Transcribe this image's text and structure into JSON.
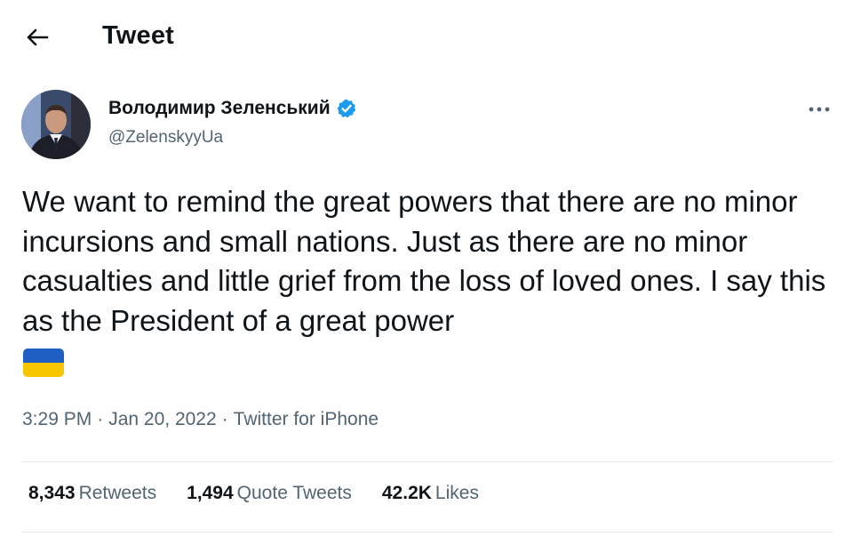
{
  "header": {
    "title": "Tweet",
    "back_icon": "arrow-left-icon"
  },
  "tweet": {
    "author": {
      "name": "Володимир Зеленський",
      "handle": "@ZelenskyyUa",
      "verified_icon": "verified-badge-icon",
      "verified_color": "#1d9bf0",
      "avatar_icon": "profile-photo"
    },
    "more_icon": "more-options-icon",
    "text": "We want to remind the great powers that there are no minor incursions and small nations. Just as there are no minor casualties and little grief from the loss of loved ones. I say this as the President of a great power",
    "emoji": "ukraine-flag-emoji",
    "flag_colors": {
      "top": "#1f5fc4",
      "bottom": "#f7c600"
    },
    "time": "3:29 PM",
    "separator": "·",
    "date": "Jan 20, 2022",
    "source": "Twitter for iPhone"
  },
  "stats": {
    "retweets": {
      "count": "8,343",
      "label": "Retweets"
    },
    "quote_tweets": {
      "count": "1,494",
      "label": "Quote Tweets"
    },
    "likes": {
      "count": "42.2K",
      "label": "Likes"
    }
  },
  "colors": {
    "text": "#0f1419",
    "secondary_text": "#536471",
    "divider": "#e6e9eb"
  }
}
